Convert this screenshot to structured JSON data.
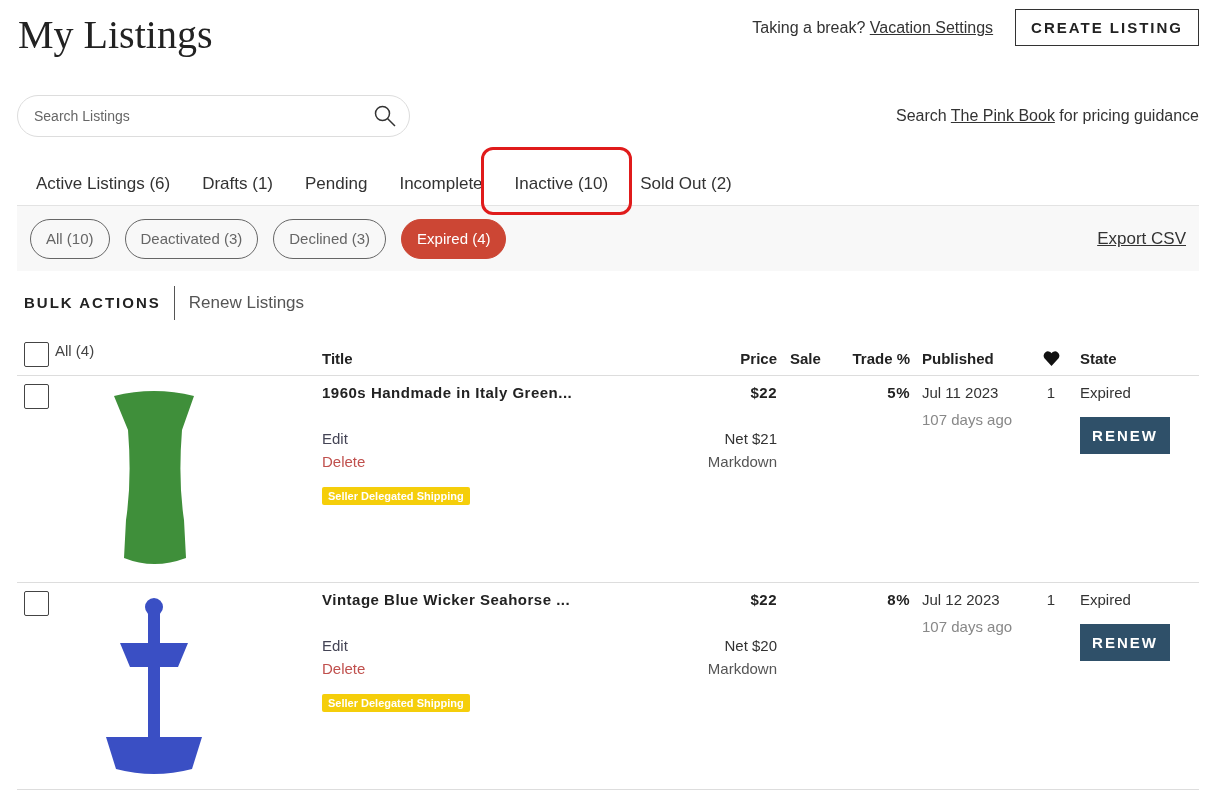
{
  "page_title": "My Listings",
  "vacation": {
    "prompt": "Taking a break?",
    "link": "Vacation Settings"
  },
  "create_button": "CREATE LISTING",
  "search": {
    "placeholder": "Search Listings"
  },
  "pricing_hint": {
    "before": "Search",
    "link": "The Pink Book",
    "after": "for pricing guidance"
  },
  "tabs": [
    {
      "label": "Active Listings (6)",
      "circled": false
    },
    {
      "label": "Drafts (1)",
      "circled": false
    },
    {
      "label": "Pending",
      "circled": false
    },
    {
      "label": "Incomplete",
      "circled": false
    },
    {
      "label": "Inactive (10)",
      "circled": true
    },
    {
      "label": "Sold Out (2)",
      "circled": false
    }
  ],
  "filters": [
    {
      "label": "All (10)",
      "selected": false
    },
    {
      "label": "Deactivated (3)",
      "selected": false
    },
    {
      "label": "Declined (3)",
      "selected": false
    },
    {
      "label": "Expired (4)",
      "selected": true
    }
  ],
  "export": "Export CSV",
  "bulk": {
    "label": "BULK ACTIONS",
    "action": "Renew Listings"
  },
  "table": {
    "select_all": {
      "label": "All (4)",
      "checked": false
    },
    "columns": [
      "Title",
      "Price",
      "Sale",
      "Trade %",
      "Published",
      "State"
    ],
    "rows": [
      {
        "checked": false,
        "kind": "vase",
        "title": "1960s Handmade in Italy Green...",
        "edit": "Edit",
        "delete": "Delete",
        "badge": "Seller Delegated Shipping",
        "price": "$22",
        "net": "Net $21",
        "markdown": "Markdown",
        "trade": "5%",
        "published": "Jul 11 2023",
        "ago": "107 days ago",
        "likes": "1",
        "state": "Expired",
        "action": "RENEW"
      },
      {
        "checked": false,
        "kind": "stand",
        "title": "Vintage Blue Wicker Seahorse ...",
        "edit": "Edit",
        "delete": "Delete",
        "badge": "Seller Delegated Shipping",
        "price": "$22",
        "net": "Net $20",
        "markdown": "Markdown",
        "trade": "8%",
        "published": "Jul 12 2023",
        "ago": "107 days ago",
        "likes": "1",
        "state": "Expired",
        "action": "RENEW"
      }
    ]
  }
}
